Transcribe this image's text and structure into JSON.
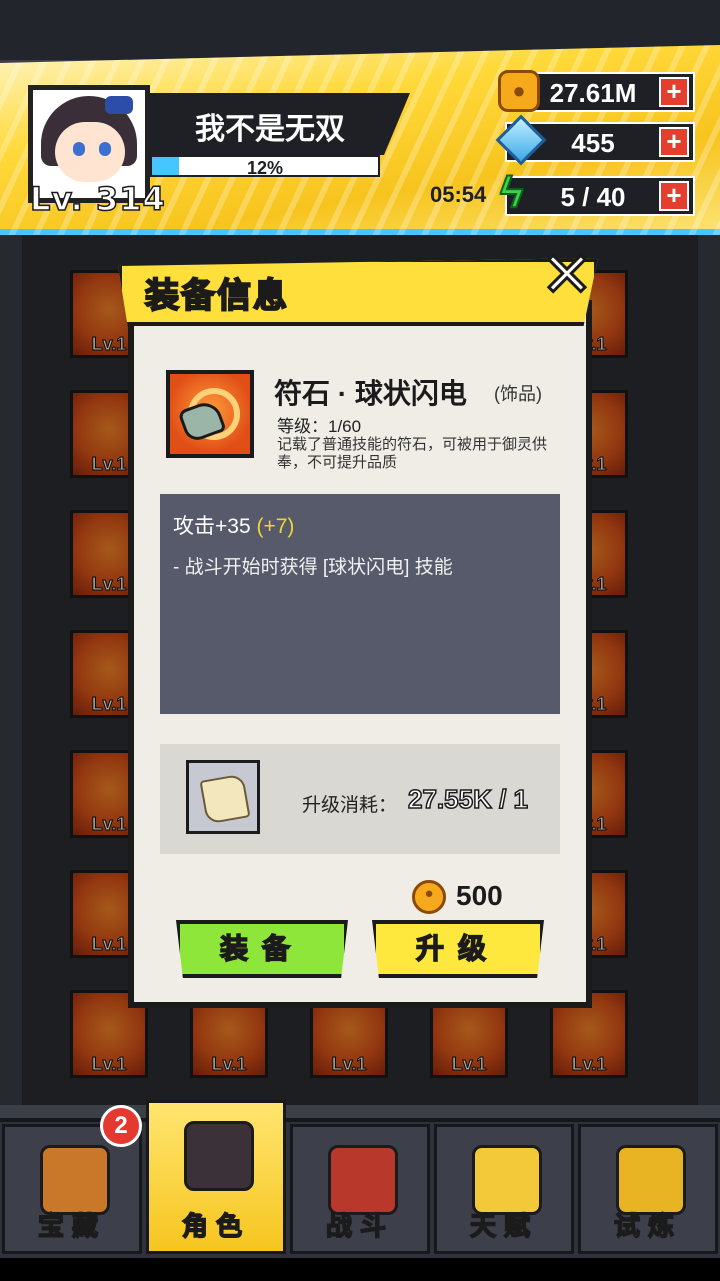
{
  "player": {
    "name": "我不是无双",
    "level_text": "Lv. 314",
    "exp_percent": 12,
    "exp_label": "12%"
  },
  "resources": {
    "coins": "27.61M",
    "gems": "455",
    "stamina": "5 / 40",
    "stamina_timer": "05:54"
  },
  "modal": {
    "title": "装备信息",
    "item_name": "符石 · 球状闪电",
    "item_type": "(饰品)",
    "item_level": "等级：1/60",
    "item_desc": "记载了普通技能的符石，可被用于御灵供奉，不可提升品质",
    "stat_main": "攻击+35",
    "stat_bonus": "(+7)",
    "skill_text": "- 战斗开始时获得 [球状闪电] 技能",
    "cost_label": "升级消耗：",
    "cost_value": "27.55K / 1",
    "price": "500",
    "equip_button": "装备",
    "upgrade_button": "升级"
  },
  "inventory": {
    "cell_level": "Lv.1"
  },
  "nav": {
    "tabs": [
      {
        "label": "宝藏",
        "icon": "treasure-chest-icon",
        "badge": "2"
      },
      {
        "label": "角色",
        "icon": "character-icon"
      },
      {
        "label": "战斗",
        "icon": "swords-icon"
      },
      {
        "label": "天赋",
        "icon": "lightbulb-icon"
      },
      {
        "label": "试炼",
        "icon": "trial-emblem-icon"
      }
    ]
  },
  "colors": {
    "header_yellow": "#ffd93a",
    "accent_blue": "#45c6ff",
    "equip_green": "#8ee63b",
    "upgrade_yellow": "#ffe83d",
    "stat_panel": "#565a6b",
    "bonus_yellow": "#f3d23a"
  }
}
